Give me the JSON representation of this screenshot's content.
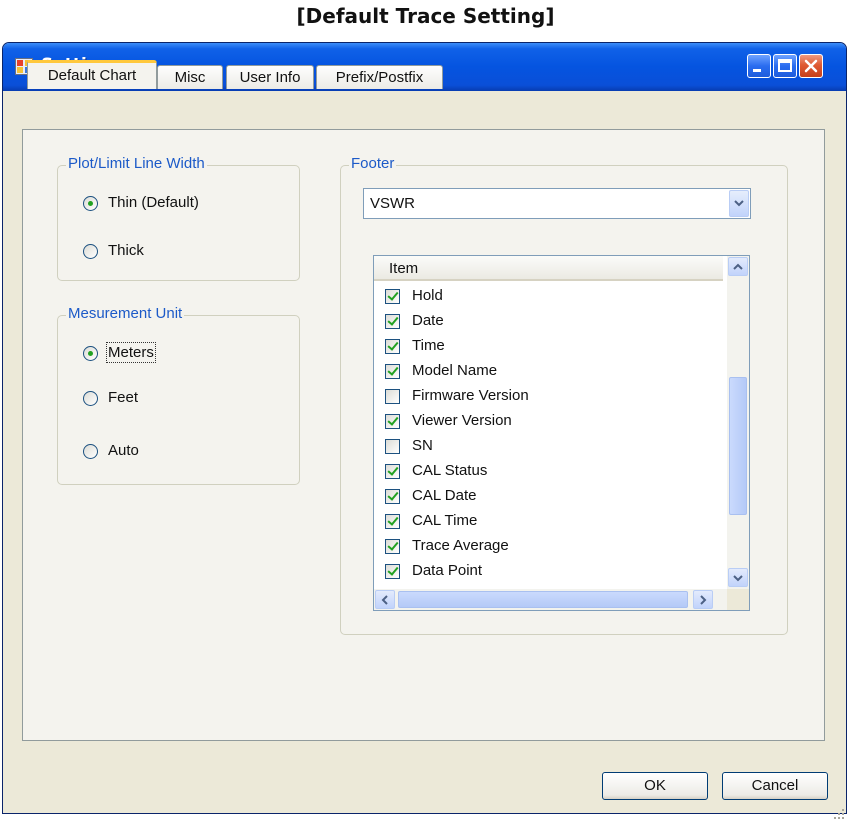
{
  "caption": "[Default Trace Setting]",
  "window": {
    "title": "Setting"
  },
  "tabs": [
    "Default Chart",
    "Misc",
    "User Info",
    "Prefix/Postfix"
  ],
  "plot_group": {
    "label": "Plot/Limit Line Width",
    "options": [
      {
        "label": "Thin (Default)",
        "checked": true
      },
      {
        "label": "Thick",
        "checked": false
      }
    ]
  },
  "unit_group": {
    "label": "Mesurement Unit",
    "options": [
      {
        "label": "Meters",
        "checked": true
      },
      {
        "label": "Feet",
        "checked": false
      },
      {
        "label": "Auto",
        "checked": false
      }
    ]
  },
  "footer_group": {
    "label": "Footer",
    "combo_value": "VSWR",
    "list_header": "Item",
    "items": [
      {
        "label": "Hold",
        "checked": true
      },
      {
        "label": "Date",
        "checked": true
      },
      {
        "label": "Time",
        "checked": true
      },
      {
        "label": "Model Name",
        "checked": true
      },
      {
        "label": "Firmware Version",
        "checked": false
      },
      {
        "label": "Viewer Version",
        "checked": true
      },
      {
        "label": "SN",
        "checked": false
      },
      {
        "label": "CAL Status",
        "checked": true
      },
      {
        "label": "CAL Date",
        "checked": true
      },
      {
        "label": "CAL Time",
        "checked": true
      },
      {
        "label": "Trace Average",
        "checked": true
      },
      {
        "label": "Data Point",
        "checked": true
      }
    ]
  },
  "buttons": {
    "ok": "OK",
    "cancel": "Cancel"
  }
}
